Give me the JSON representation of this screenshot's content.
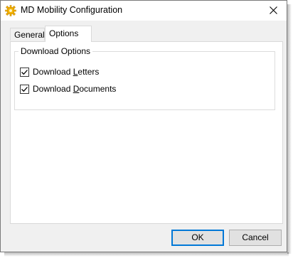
{
  "window": {
    "title": "MD Mobility Configuration",
    "icon": "gear-icon",
    "close_icon": "close-icon"
  },
  "tabs": [
    {
      "label": "General",
      "selected": false
    },
    {
      "label": "Options",
      "selected": true
    }
  ],
  "download_options": {
    "legend": "Download Options",
    "items": [
      {
        "label_pre": "Download ",
        "accel": "L",
        "label_post": "etters",
        "checked": true
      },
      {
        "label_pre": "Download ",
        "accel": "D",
        "label_post": "ocuments",
        "checked": true
      }
    ]
  },
  "buttons": {
    "ok": "OK",
    "cancel": "Cancel"
  },
  "colors": {
    "focus_border": "#0078d7",
    "icon_yellow": "#f5b400"
  }
}
